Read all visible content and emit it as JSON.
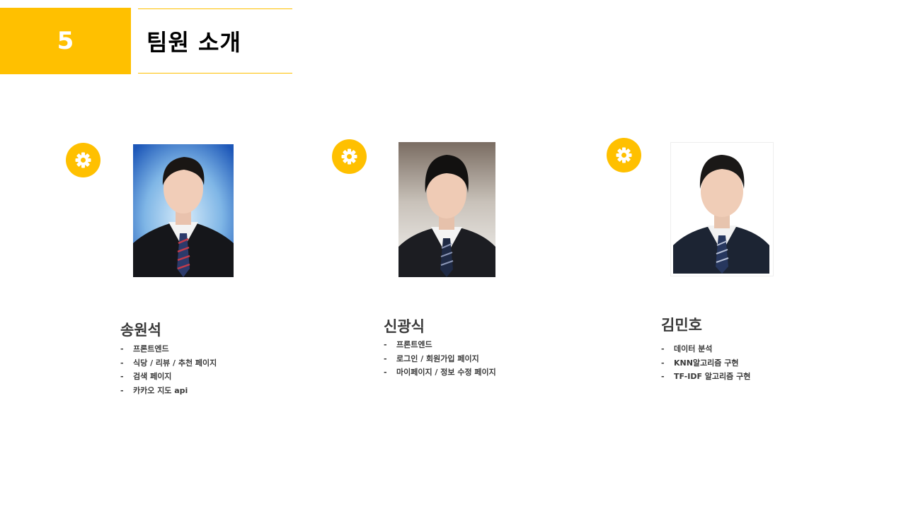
{
  "header": {
    "section_number": "5",
    "title": "팀원 소개",
    "accent_color": "#FFC000"
  },
  "members": [
    {
      "icon": "gear-icon",
      "name": "송원석",
      "tasks": [
        "프론트엔드",
        "식당 / 리뷰 / 추천 페이지",
        "검색 페이지",
        "카카오 지도 api"
      ]
    },
    {
      "icon": "gear-icon",
      "name": "신광식",
      "tasks": [
        "프론트엔드",
        "로그인 / 회원가입 페이지",
        "마이페이지 / 정보 수정 페이지"
      ]
    },
    {
      "icon": "gear-icon",
      "name": "김민호",
      "tasks": [
        "데이터 분석",
        "KNN알고리즘 구현",
        "TF-IDF 알고리즘 구현"
      ]
    }
  ]
}
